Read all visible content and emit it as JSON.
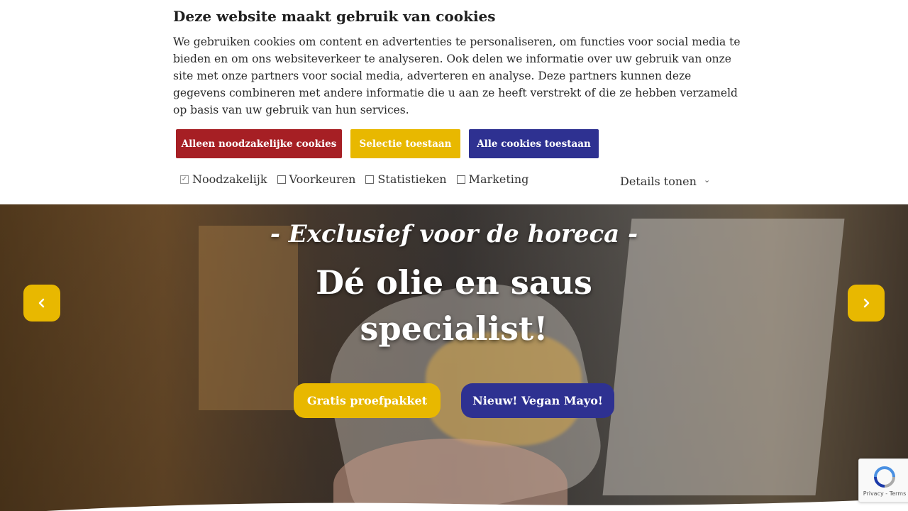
{
  "cookie_banner": {
    "title": "Deze website maakt gebruik van cookies",
    "text": "We gebruiken cookies om content en advertenties te personaliseren, om functies voor social media te bieden en om ons websiteverkeer te analyseren. Ook delen we informatie over uw gebruik van onze site met onze partners voor social media, adverteren en analyse. Deze partners kunnen deze gegevens combineren met andere informatie die u aan ze heeft verstrekt of die ze hebben verzameld op basis van uw gebruik van hun services.",
    "buttons": {
      "necessary": "Alleen noodzakelijke cookies",
      "selection": "Selectie toestaan",
      "all": "Alle cookies toestaan"
    },
    "options": [
      {
        "label": "Noodzakelijk",
        "checked": true
      },
      {
        "label": "Voorkeuren",
        "checked": false
      },
      {
        "label": "Statistieken",
        "checked": false
      },
      {
        "label": "Marketing",
        "checked": false
      }
    ],
    "details_label": "Details tonen"
  },
  "hero": {
    "subtitle": "- Exclusief voor de horeca -",
    "title_line1": "Dé olie en saus",
    "title_line2": "specialist!",
    "button_trial": "Gratis proefpakket",
    "button_vegan": "Nieuw! Vegan Mayo!"
  },
  "recaptcha": {
    "text": "Privacy - Terms"
  },
  "colors": {
    "red": "#a61f24",
    "yellow": "#e8b800",
    "blue": "#2e3191"
  }
}
